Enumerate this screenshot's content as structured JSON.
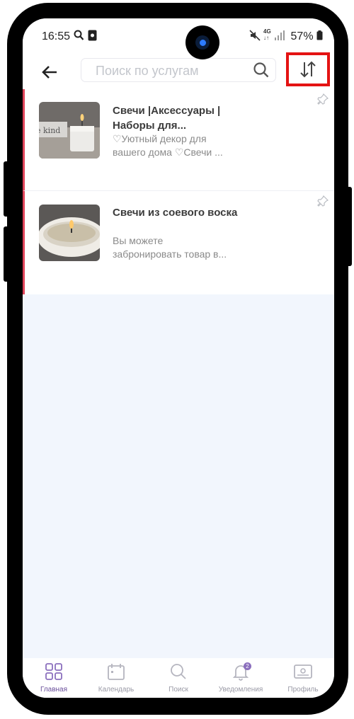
{
  "status_bar": {
    "time": "16:55",
    "network": "4G",
    "battery": "57%"
  },
  "search": {
    "placeholder": "Поиск по услугам"
  },
  "items": [
    {
      "title": "Свечи |Аксессуары | Наборы для...",
      "desc_line1": "♡Уютный декор для",
      "desc_line2": "вашего дома ♡Свечи ..."
    },
    {
      "title": "Свечи из соевого воска",
      "desc_line1": "Вы можете",
      "desc_line2": "забронировать товар в..."
    }
  ],
  "nav": {
    "home": "Главная",
    "calendar": "Календарь",
    "search": "Поиск",
    "notifications": "Уведомления",
    "notifications_badge": "2",
    "profile": "Профиль"
  },
  "colors": {
    "accent": "#6a4f9b",
    "highlight": "#e41313",
    "item_marker": "#e0445a"
  }
}
